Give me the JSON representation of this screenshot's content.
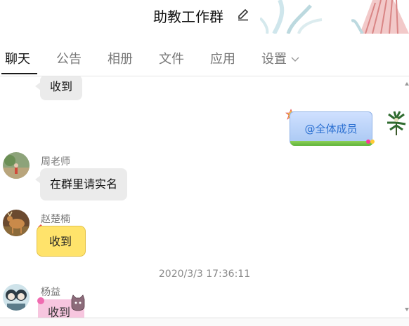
{
  "header": {
    "title": "助教工作群"
  },
  "tabs": [
    {
      "label": "聊天",
      "active": true
    },
    {
      "label": "公告"
    },
    {
      "label": "相册"
    },
    {
      "label": "文件"
    },
    {
      "label": "应用"
    },
    {
      "label": "设置"
    }
  ],
  "messages": [
    {
      "sender": "",
      "text": "收到",
      "side": "left",
      "style": "gray"
    },
    {
      "sender": "",
      "text": "@全体成员",
      "side": "right",
      "style": "blue-grass"
    },
    {
      "sender": "周老师",
      "text": "在群里请实名",
      "side": "left",
      "style": "gray"
    },
    {
      "sender": "赵楚楠",
      "text": "收到",
      "side": "left",
      "style": "yellow"
    },
    {
      "timestamp": "2020/3/3 17:36:11"
    },
    {
      "sender": "杨益",
      "text": "收到",
      "side": "left",
      "style": "pink"
    }
  ],
  "colors": {
    "bubble_gray": "#ebebeb",
    "bubble_blue_text": "#2a6fd1",
    "bubble_yellow": "#ffe36b",
    "bubble_pink": "#f7c6df",
    "tab_active": "#111111",
    "tab_inactive": "#777777"
  },
  "icons": {
    "title_action": "pencil-edit-icon",
    "settings_dropdown": "chevron-down-icon"
  }
}
